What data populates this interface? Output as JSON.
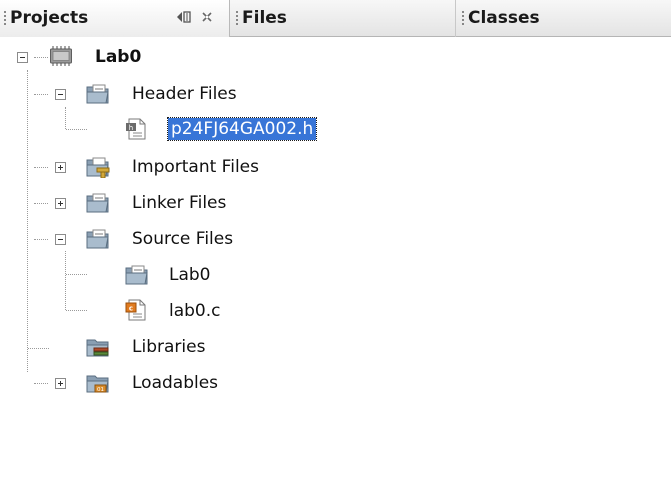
{
  "tabs": [
    {
      "label": "Projects"
    },
    {
      "label": "Files"
    },
    {
      "label": "Classes"
    }
  ],
  "tree": {
    "project": "Lab0",
    "header_files": "Header Files",
    "header_file_1": "p24FJ64GA002.h",
    "important_files": "Important Files",
    "linker_files": "Linker Files",
    "source_files": "Source Files",
    "source_folder": "Lab0",
    "source_file_1": "lab0.c",
    "libraries": "Libraries",
    "loadables": "Loadables"
  }
}
